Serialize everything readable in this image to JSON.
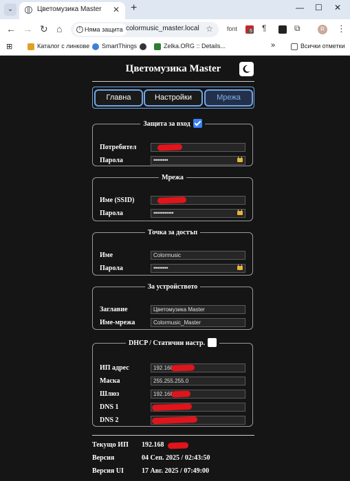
{
  "browser": {
    "tab_title": "Цветомузика Master",
    "new_tab_label": "+",
    "security_label": "Няма защита",
    "url": "colormusic_master.local",
    "ext_font_label": "font",
    "ext_badge_count": "5",
    "profile_initial": "R",
    "bookmarks": [
      "Каталог с линкове",
      "SmartThings",
      "Zelka.ORG :: Details...",
      "Всички отметки"
    ],
    "more_bookmarks": "»"
  },
  "app": {
    "title": "Цветомузика Master",
    "tabs": [
      {
        "label": "Главна",
        "active": false
      },
      {
        "label": "Настройки",
        "active": false
      },
      {
        "label": "Мрежа",
        "active": true
      }
    ],
    "sections": {
      "login": {
        "legend": "Защита за вход",
        "enabled": true,
        "user_label": "Потребител",
        "user_value": "",
        "pass_label": "Парола",
        "pass_value": "••••••••"
      },
      "network": {
        "legend": "Мрежа",
        "ssid_label": "Име (SSID)",
        "ssid_value": "",
        "pass_label": "Парола",
        "pass_value": "•••••••••••"
      },
      "ap": {
        "legend": "Точка за достъп",
        "name_label": "Име",
        "name_value": "Colormusic",
        "pass_label": "Парола",
        "pass_value": "••••••••"
      },
      "device": {
        "legend": "За устройството",
        "title_label": "Заглавие",
        "title_value": "Цветомузика Master",
        "netname_label": "Име-мрежа",
        "netname_value": "Colormusic_Master"
      },
      "dhcp": {
        "legend": "DHCP / Статични настр.",
        "static_enabled": false,
        "ip_label": "ИП адрес",
        "ip_value": "192.168",
        "mask_label": "Маска",
        "mask_value": "255.255.255.0",
        "gw_label": "Шлюз",
        "gw_value": "192.168",
        "dns1_label": "DNS 1",
        "dns1_value": "",
        "dns2_label": "DNS 2",
        "dns2_value": ""
      }
    },
    "info": {
      "ip_label": "Текущо ИП",
      "ip_value": "192.168",
      "version_label": "Версия",
      "version_value": "04 Сеп. 2025 / 02:43:50",
      "ui_version_label": "Версия UI",
      "ui_version_value": "17 Авг. 2025 / 07:49:00"
    }
  },
  "colors": {
    "accent": "#6fa6e6",
    "background": "#151515",
    "redaction": "#e0141b",
    "checkbox": "#3b82f6",
    "lock": "#e8b52d"
  }
}
